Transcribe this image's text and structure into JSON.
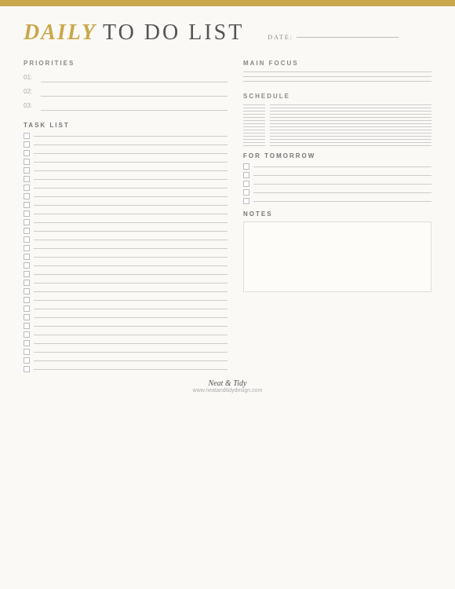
{
  "header": {
    "title_daily": "DAILY",
    "title_rest": "TO DO LIST",
    "date_label": "DATE:"
  },
  "sections": {
    "priorities": {
      "label": "PRIORITIES",
      "items": [
        {
          "num": "01:"
        },
        {
          "num": "02:"
        },
        {
          "num": "03:"
        }
      ]
    },
    "main_focus": {
      "label": "MAIN FOCUS",
      "lines": 3
    },
    "task_list": {
      "label": "TASK LIST",
      "count": 28
    },
    "schedule": {
      "label": "SCHEDULE",
      "count": 14
    },
    "for_tomorrow": {
      "label": "FOR TOMORROW",
      "count": 5
    },
    "notes": {
      "label": "NOTES"
    }
  },
  "footer": {
    "brand": "Neat & Tidy",
    "url": "www.neatandtidydesign.com"
  }
}
